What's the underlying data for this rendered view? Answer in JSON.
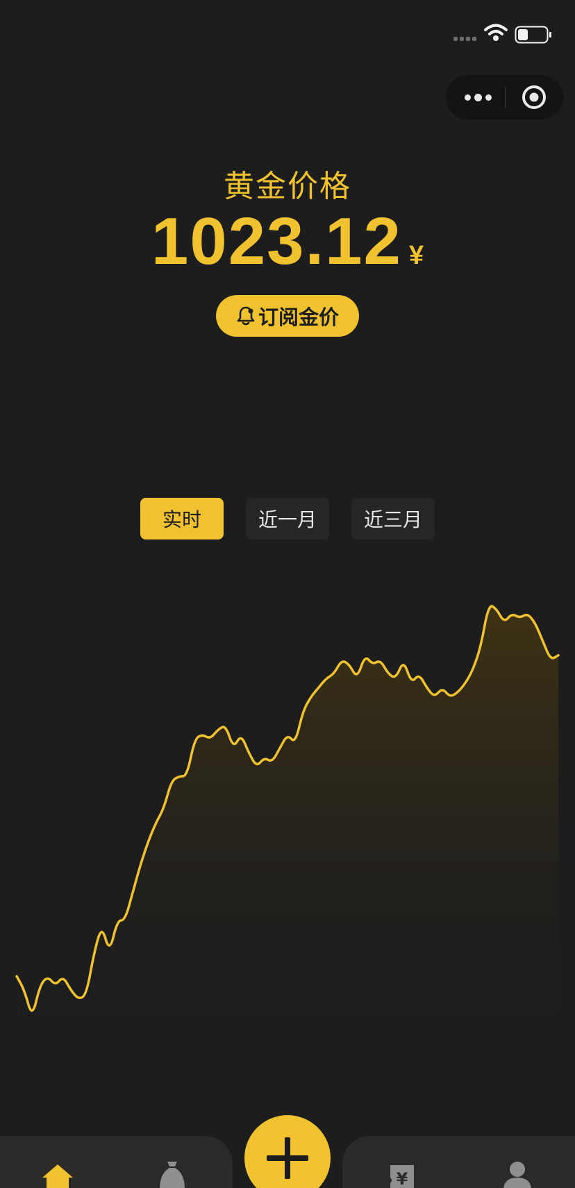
{
  "status_bar": {
    "time": ""
  },
  "header": {
    "title": "黄金价格",
    "price": "1023.12",
    "currency": "¥",
    "subscribe_label": "订阅金价"
  },
  "tabs": [
    {
      "label": "实时",
      "active": true
    },
    {
      "label": "近一月",
      "active": false
    },
    {
      "label": "近三月",
      "active": false
    }
  ],
  "colors": {
    "accent": "#f0c230",
    "background": "#1d1d1e",
    "tab_inactive": "#262627",
    "nav_bar": "#2b2a28"
  },
  "chart_data": {
    "type": "area",
    "title": "",
    "xlabel": "",
    "ylabel": "",
    "grid": false,
    "ylim": [
      0,
      100
    ],
    "values": [
      20,
      17,
      11,
      18,
      20,
      18,
      20,
      17,
      15,
      16,
      25,
      31,
      25,
      32,
      32,
      38,
      44,
      49,
      53,
      56,
      62,
      63,
      63,
      71,
      72,
      71,
      73,
      74,
      69,
      72,
      68,
      65,
      67,
      66,
      69,
      72,
      70,
      77,
      80,
      82,
      84,
      85,
      88,
      87,
      84,
      89,
      87,
      88,
      85,
      84,
      88,
      83,
      85,
      82,
      80,
      82,
      80,
      81,
      83,
      86,
      91,
      100,
      99,
      96,
      98,
      97,
      98,
      96,
      92,
      88,
      89
    ],
    "area_fill": "#4a3a10"
  },
  "bottom_nav": {
    "items": [
      {
        "icon": "home-icon",
        "active": true
      },
      {
        "icon": "money-bag-icon",
        "active": false
      },
      {
        "icon": "add-icon",
        "active": false
      },
      {
        "icon": "bill-icon",
        "active": false
      },
      {
        "icon": "user-icon",
        "active": false
      }
    ]
  }
}
